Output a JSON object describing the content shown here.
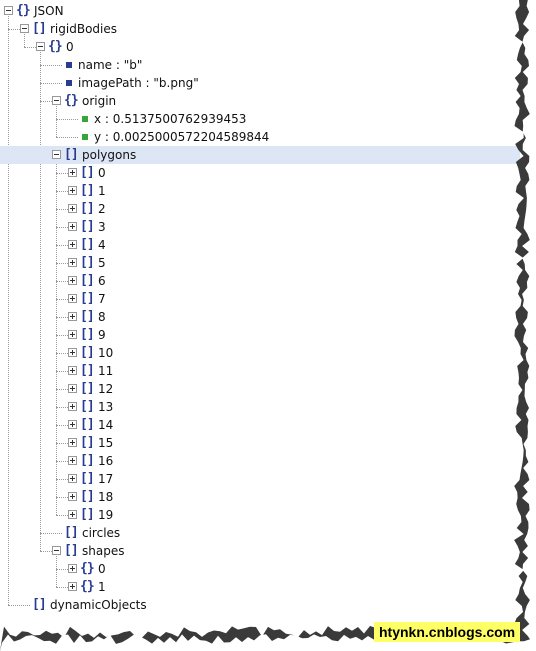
{
  "tree": {
    "root": {
      "label": "JSON",
      "type": "object"
    },
    "rigidBodies": {
      "label": "rigidBodies",
      "type": "array"
    },
    "body0": {
      "label": "0",
      "type": "object",
      "name": "name : \"b\"",
      "imagePath": "imagePath : \"b.png\""
    },
    "origin": {
      "label": "origin",
      "type": "object",
      "x": "x : 0.5137500762939453",
      "y": "y : 0.0025000572204589844"
    },
    "polygons": {
      "label": "polygons",
      "type": "array",
      "selected": true,
      "children": [
        "0",
        "1",
        "2",
        "3",
        "4",
        "5",
        "6",
        "7",
        "8",
        "9",
        "10",
        "11",
        "12",
        "13",
        "14",
        "15",
        "16",
        "17",
        "18",
        "19"
      ]
    },
    "circles": {
      "label": "circles",
      "type": "array"
    },
    "shapes": {
      "label": "shapes",
      "type": "array",
      "children": [
        "0",
        "1"
      ]
    },
    "dynamicObjects": {
      "label": "dynamicObjects",
      "type": "array"
    }
  },
  "icons": {
    "object_glyph": "{}",
    "array_glyph": "[]",
    "string_leaf_color": "#2a3c8f",
    "number_leaf_color": "#3aa33a",
    "selection_color": "#dce6f5"
  },
  "watermark": {
    "text": "htynkn.cnblogs.com"
  }
}
